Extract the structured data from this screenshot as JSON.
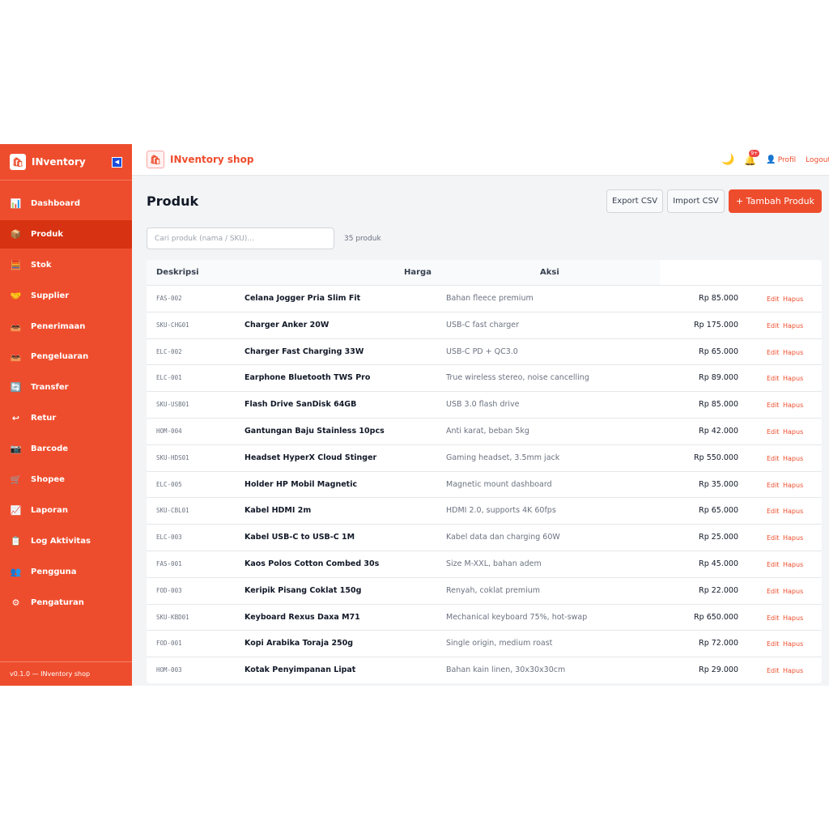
{
  "sidebar": {
    "brand": "INventory",
    "logo_glyph": "🛍",
    "collapse_glyph": "◀",
    "items": [
      {
        "label": "Dashboard",
        "icon": "📊",
        "name": "dashboard"
      },
      {
        "label": "Produk",
        "icon": "📦",
        "name": "produk",
        "active": true
      },
      {
        "label": "Stok",
        "icon": "🧮",
        "name": "stok"
      },
      {
        "label": "Supplier",
        "icon": "🤝",
        "name": "supplier"
      },
      {
        "label": "Penerimaan",
        "icon": "📥",
        "name": "penerimaan"
      },
      {
        "label": "Pengeluaran",
        "icon": "📤",
        "name": "pengeluaran"
      },
      {
        "label": "Transfer",
        "icon": "🔄",
        "name": "transfer"
      },
      {
        "label": "Retur",
        "icon": "↩",
        "name": "retur"
      },
      {
        "label": "Barcode",
        "icon": "📷",
        "name": "barcode"
      },
      {
        "label": "Shopee",
        "icon": "🛒",
        "name": "shopee"
      },
      {
        "label": "Laporan",
        "icon": "📈",
        "name": "laporan"
      },
      {
        "label": "Log Aktivitas",
        "icon": "📋",
        "name": "log-aktivitas"
      },
      {
        "label": "Pengguna",
        "icon": "👥",
        "name": "pengguna"
      },
      {
        "label": "Pengaturan",
        "icon": "⚙",
        "name": "pengaturan"
      }
    ],
    "footer": "v0.1.0 — INventory shop"
  },
  "topbar": {
    "title": "INventory shop",
    "logo_glyph": "🛍",
    "moon_glyph": "🌙",
    "bell_glyph": "🔔",
    "badge": "9+",
    "user_glyph": "👤",
    "profil": "Profil",
    "logout": "Logout"
  },
  "page": {
    "title": "Produk",
    "export_label": "Export CSV",
    "import_label": "Import CSV",
    "add_label": "+ Tambah Produk",
    "search_placeholder": "Cari produk (nama / SKU)...",
    "count": "35 produk"
  },
  "table": {
    "headers": {
      "desc": "Deskripsi",
      "price": "Harga",
      "action": "Aksi"
    },
    "edit_label": "Edit",
    "delete_label": "Hapus",
    "rows": [
      {
        "sku": "FAS-002",
        "name": "Celana Jogger Pria Slim Fit",
        "desc": "Bahan fleece premium",
        "price": "Rp 85.000"
      },
      {
        "sku": "SKU-CHG01",
        "name": "Charger Anker 20W",
        "desc": "USB-C fast charger",
        "price": "Rp 175.000"
      },
      {
        "sku": "ELC-002",
        "name": "Charger Fast Charging 33W",
        "desc": "USB-C PD + QC3.0",
        "price": "Rp 65.000"
      },
      {
        "sku": "ELC-001",
        "name": "Earphone Bluetooth TWS Pro",
        "desc": "True wireless stereo, noise cancelling",
        "price": "Rp 89.000"
      },
      {
        "sku": "SKU-USB01",
        "name": "Flash Drive SanDisk 64GB",
        "desc": "USB 3.0 flash drive",
        "price": "Rp 85.000"
      },
      {
        "sku": "HOM-004",
        "name": "Gantungan Baju Stainless 10pcs",
        "desc": "Anti karat, beban 5kg",
        "price": "Rp 42.000"
      },
      {
        "sku": "SKU-HDS01",
        "name": "Headset HyperX Cloud Stinger",
        "desc": "Gaming headset, 3.5mm jack",
        "price": "Rp 550.000"
      },
      {
        "sku": "ELC-005",
        "name": "Holder HP Mobil Magnetic",
        "desc": "Magnetic mount dashboard",
        "price": "Rp 35.000"
      },
      {
        "sku": "SKU-CBL01",
        "name": "Kabel HDMI 2m",
        "desc": "HDMI 2.0, supports 4K 60fps",
        "price": "Rp 65.000"
      },
      {
        "sku": "ELC-003",
        "name": "Kabel USB-C to USB-C 1M",
        "desc": "Kabel data dan charging 60W",
        "price": "Rp 25.000"
      },
      {
        "sku": "FAS-001",
        "name": "Kaos Polos Cotton Combed 30s",
        "desc": "Size M-XXL, bahan adem",
        "price": "Rp 45.000"
      },
      {
        "sku": "FOD-003",
        "name": "Keripik Pisang Coklat 150g",
        "desc": "Renyah, coklat premium",
        "price": "Rp 22.000"
      },
      {
        "sku": "SKU-KBD01",
        "name": "Keyboard Rexus Daxa M71",
        "desc": "Mechanical keyboard 75%, hot-swap",
        "price": "Rp 650.000"
      },
      {
        "sku": "FOD-001",
        "name": "Kopi Arabika Toraja 250g",
        "desc": "Single origin, medium roast",
        "price": "Rp 72.000"
      },
      {
        "sku": "HOM-003",
        "name": "Kotak Penyimpanan Lipat",
        "desc": "Bahan kain linen, 30x30x30cm",
        "price": "Rp 29.000"
      }
    ]
  },
  "colors": {
    "accent": "#ee4d2d",
    "accent_dark": "#d73211"
  }
}
